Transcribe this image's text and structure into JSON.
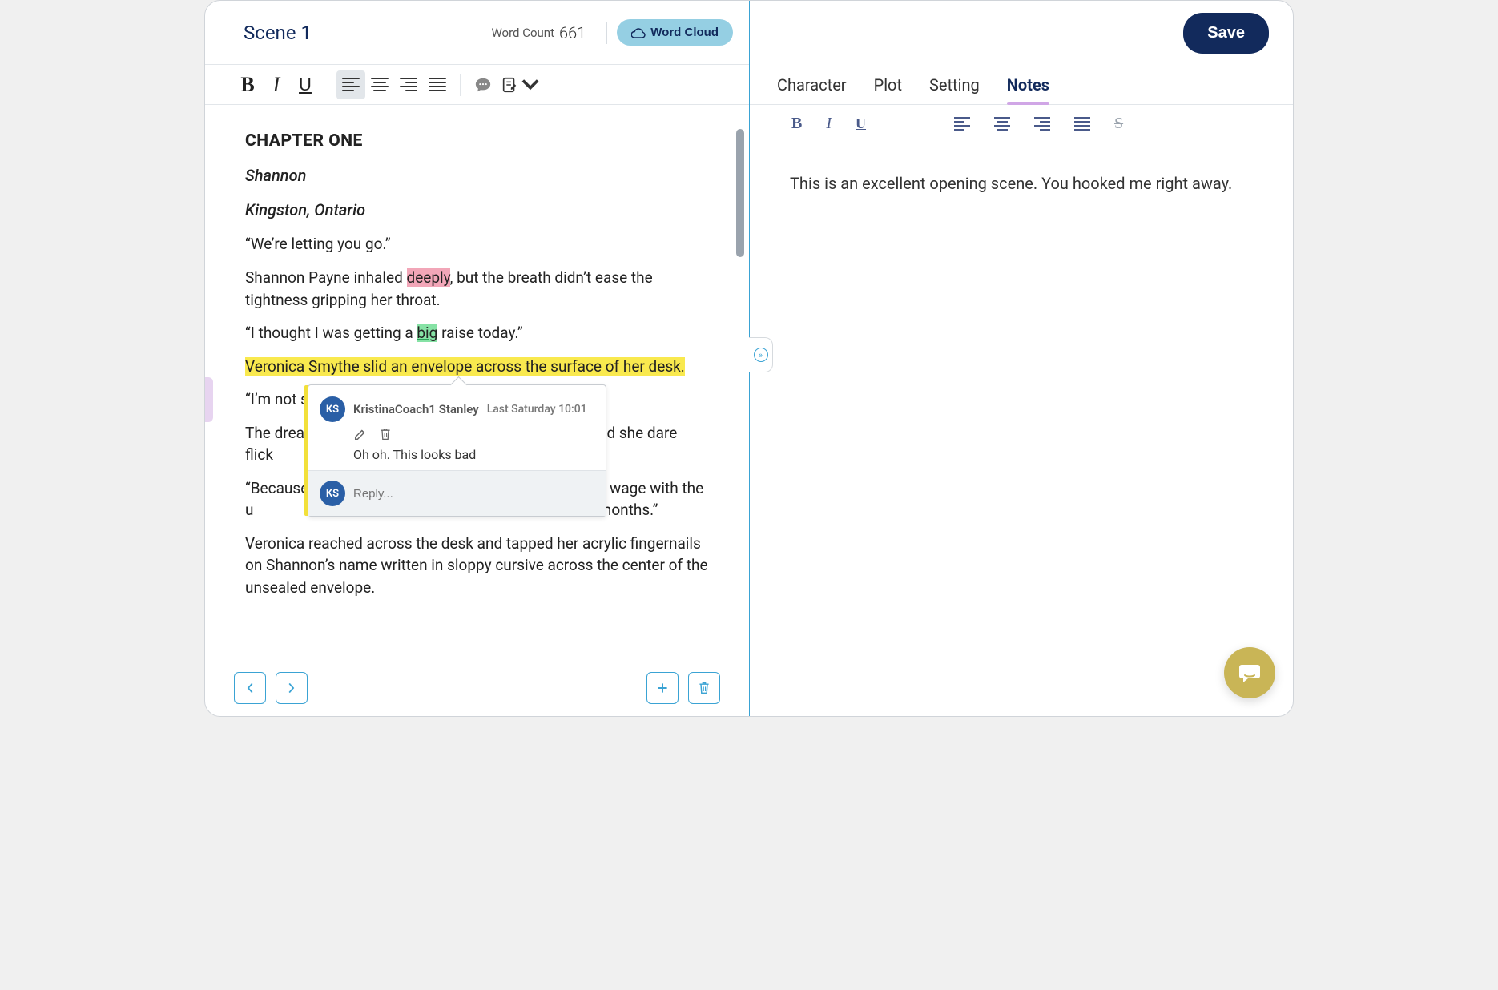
{
  "left": {
    "scene_title": "Scene 1",
    "word_count_label": "Word Count",
    "word_count_value": "661",
    "word_cloud_label": "Word Cloud"
  },
  "editor": {
    "chapter": "CHAPTER ONE",
    "name": "Shannon",
    "location": "Kingston, Ontario",
    "p1": "“We’re letting you go.”",
    "p2a": "Shannon Payne inhaled ",
    "p2_hl": "deeply",
    "p2b": ", but the breath didn’t ease the tightness gripping her throat.",
    "p3a": "“I thought I was getting a ",
    "p3_hl": "big",
    "p3b": " raise today.”",
    "p4": "Veronica Smythe slid an envelope across the surface of her desk.",
    "p5": "“I’m not s",
    "p6a": "The dread",
    "p6b": "n. Did she dare flick",
    "p7a": "“Because",
    "p7b": "ower wage with the u",
    "p7c": "e end of three months.”",
    "p8": "Veronica reached across the desk and tapped her acrylic fingernails on Shannon’s name written in sloppy cursive across the center of the unsealed envelope."
  },
  "comment": {
    "avatar_initials": "KS",
    "name": "KristinaCoach1 Stanley",
    "time": "Last Saturday 10:01",
    "text": "Oh oh. This looks bad",
    "reply_placeholder": "Reply..."
  },
  "right": {
    "save_label": "Save",
    "tabs": [
      "Character",
      "Plot",
      "Setting",
      "Notes"
    ],
    "active_tab_index": 3,
    "notes_text": "This is an excellent opening scene. You hooked me right away."
  }
}
